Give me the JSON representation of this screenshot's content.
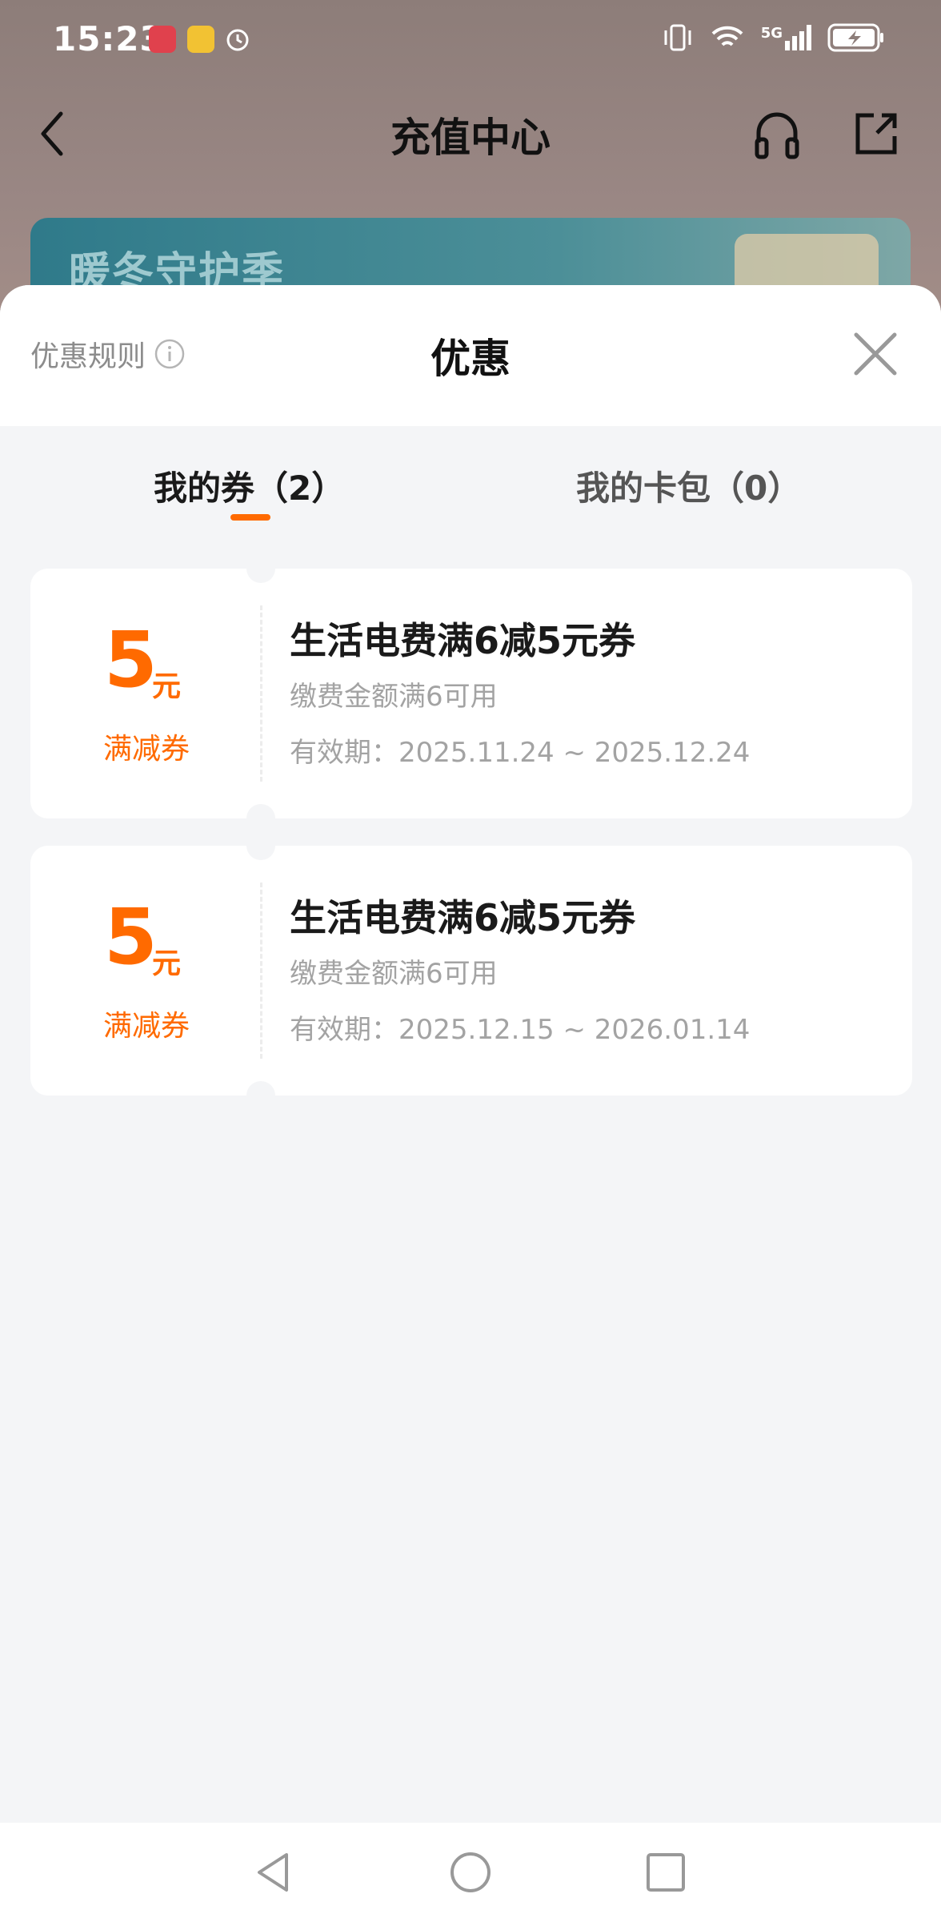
{
  "status_bar": {
    "time": "15:23",
    "left_icons": [
      "huawei-app-icon",
      "weibo-app-icon",
      "alarm-icon"
    ],
    "right_icons": [
      "vibrate-icon",
      "wifi-icon",
      "signal-5g-icon",
      "battery-charging-icon"
    ],
    "network": "5G"
  },
  "nav": {
    "title": "充值中心",
    "back_icon": "back-arrow-icon",
    "support_icon": "headset-icon",
    "share_icon": "share-icon"
  },
  "banner": {
    "text": "暖冬守护季"
  },
  "sheet": {
    "title": "优惠",
    "rule_label": "优惠规则",
    "tabs": [
      {
        "label": "我的券（2）",
        "active": true
      },
      {
        "label": "我的卡包（0）",
        "active": false
      }
    ],
    "coupons": [
      {
        "amount": "5",
        "unit": "元",
        "type": "满减券",
        "title": "生活电费满6减5元券",
        "condition": "缴费金额满6可用",
        "validity": "有效期：2025.11.24 ~ 2025.12.24"
      },
      {
        "amount": "5",
        "unit": "元",
        "type": "满减券",
        "title": "生活电费满6减5元券",
        "condition": "缴费金额满6可用",
        "validity": "有效期：2025.12.15 ~ 2026.01.14"
      }
    ]
  },
  "colors": {
    "accent": "#ff6a00",
    "background": "#f4f5f7"
  }
}
